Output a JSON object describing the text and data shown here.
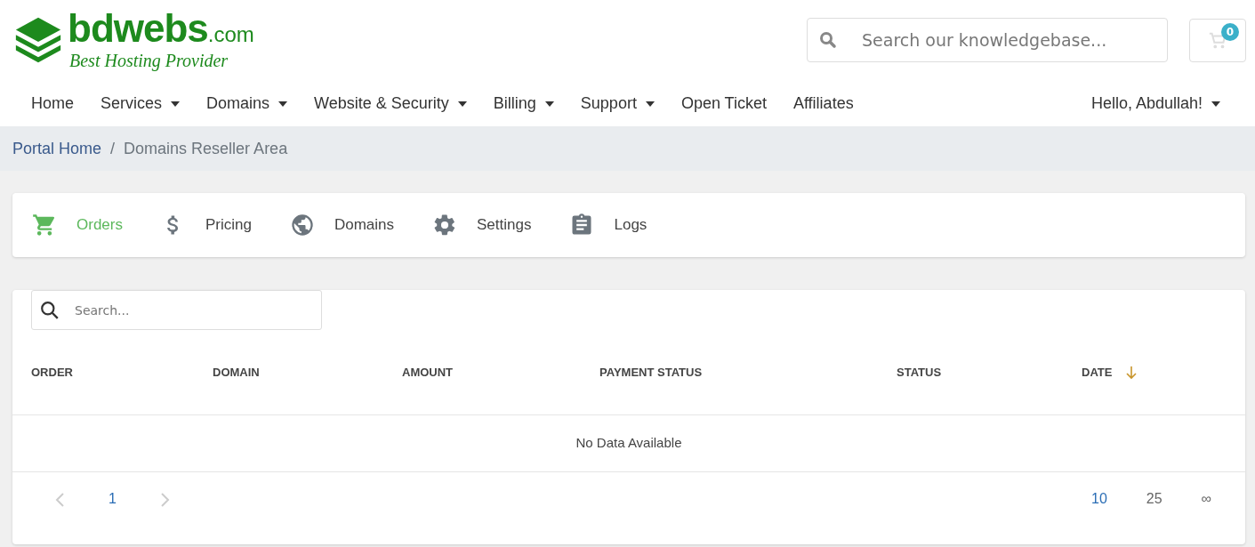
{
  "logo": {
    "name": "bdwebs",
    "suffix": ".com",
    "tagline": "Best Hosting Provider"
  },
  "header_search": {
    "placeholder": "Search our knowledgebase..."
  },
  "cart": {
    "count": "0"
  },
  "nav": [
    {
      "label": "Home",
      "dropdown": false
    },
    {
      "label": "Services",
      "dropdown": true
    },
    {
      "label": "Domains",
      "dropdown": true
    },
    {
      "label": "Website & Security",
      "dropdown": true
    },
    {
      "label": "Billing",
      "dropdown": true
    },
    {
      "label": "Support",
      "dropdown": true
    },
    {
      "label": "Open Ticket",
      "dropdown": false
    },
    {
      "label": "Affiliates",
      "dropdown": false
    }
  ],
  "user_menu": {
    "label": "Hello, Abdullah!",
    "dropdown": true
  },
  "breadcrumb": {
    "separator": "/",
    "items": [
      {
        "label": "Portal Home",
        "link": true
      },
      {
        "label": "Domains Reseller Area",
        "link": false
      }
    ]
  },
  "tabs": [
    {
      "label": "Orders",
      "kind": "cart",
      "selected": true
    },
    {
      "label": "Pricing",
      "kind": "dollar",
      "selected": false
    },
    {
      "label": "Domains",
      "kind": "globe",
      "selected": false
    },
    {
      "label": "Settings",
      "kind": "gear",
      "selected": false
    },
    {
      "label": "Logs",
      "kind": "clipboard",
      "selected": false
    }
  ],
  "table": {
    "search": {
      "placeholder": "Search..."
    },
    "columns": [
      {
        "label": "ORDER",
        "sorted": false
      },
      {
        "label": "DOMAIN",
        "sorted": false
      },
      {
        "label": "AMOUNT",
        "sorted": false
      },
      {
        "label": "PAYMENT STATUS",
        "sorted": false
      },
      {
        "label": "STATUS",
        "sorted": false
      },
      {
        "label": "DATE",
        "sorted": true
      }
    ],
    "empty_message": "No Data Available",
    "pages": [
      {
        "label": "1",
        "selected": true
      }
    ],
    "page_sizes": [
      {
        "label": "10",
        "selected": true
      },
      {
        "label": "25",
        "selected": false
      },
      {
        "label": "∞",
        "selected": false
      }
    ]
  }
}
